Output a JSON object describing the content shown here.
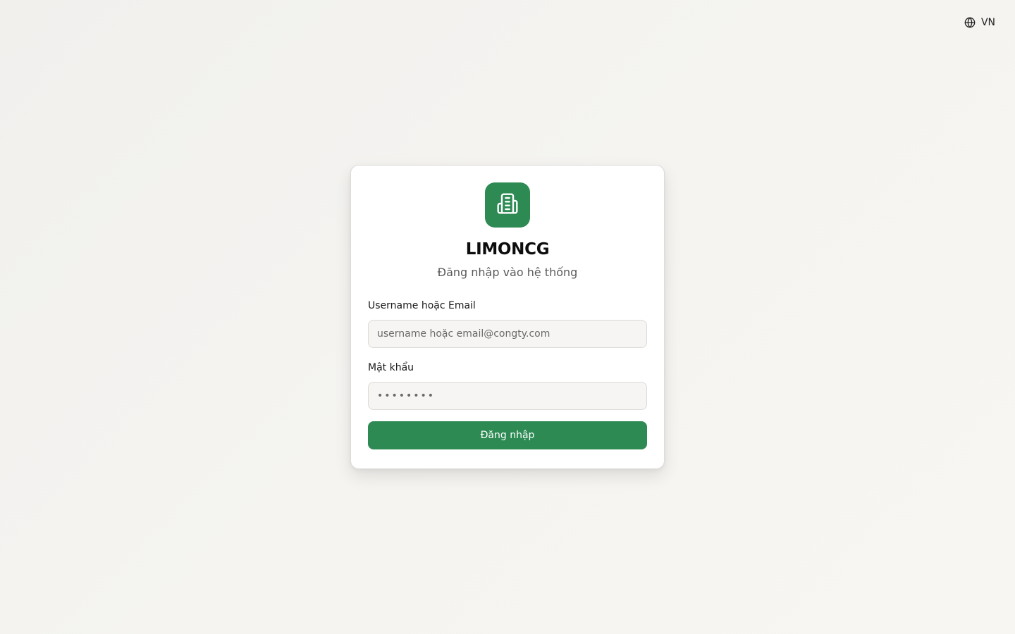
{
  "language": {
    "label": "VN",
    "icon": "globe-icon"
  },
  "brand": {
    "name": "LIMONCG",
    "subtitle": "Đăng nhập vào hệ thống",
    "icon": "building-icon",
    "color": "#2d8a53"
  },
  "form": {
    "username": {
      "label": "Username hoặc Email",
      "placeholder": "username hoặc email@congty.com",
      "value": ""
    },
    "password": {
      "label": "Mật khẩu",
      "placeholder": "••••••••",
      "value": ""
    },
    "submit_label": "Đăng nhập"
  }
}
